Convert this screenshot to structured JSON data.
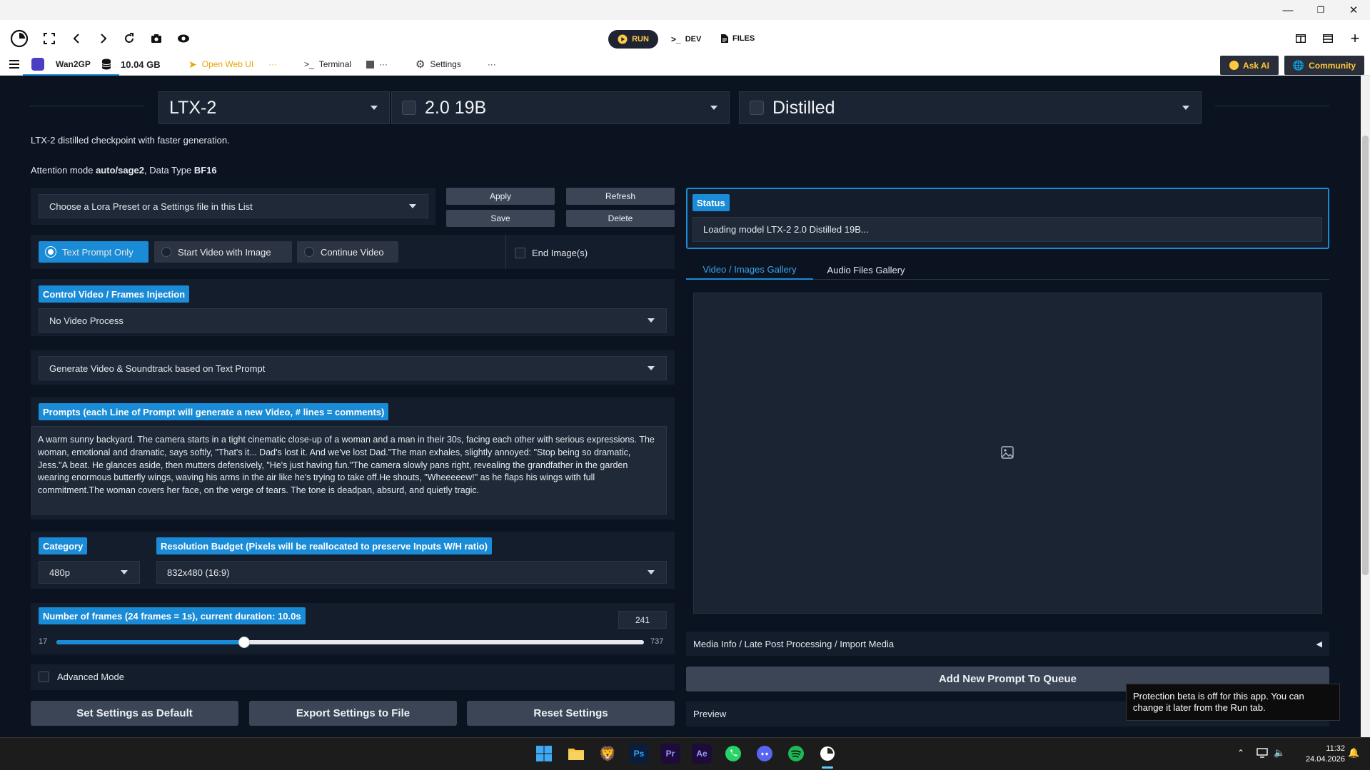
{
  "window": {
    "minimize_glyph": "—",
    "restore_glyph": "❐",
    "close_glyph": "✕"
  },
  "toolbar": {
    "run_label": "RUN",
    "dev_label": "DEV",
    "files_label": "FILES"
  },
  "tabs": {
    "app_name": "Wan2GP",
    "storage": "10.04 GB",
    "open_web_ui": "Open Web UI",
    "terminal": "Terminal",
    "settings": "Settings",
    "more": "···",
    "ask_ai": "Ask AI",
    "community": "Community"
  },
  "model": {
    "family": "LTX-2",
    "version": "2.0 19B",
    "variant": "Distilled",
    "description": "LTX-2 distilled checkpoint with faster generation.",
    "attention_prefix": "Attention mode ",
    "attention_mode": "auto/sage2",
    "datatype_prefix": ", Data Type ",
    "data_type": "BF16"
  },
  "lora": {
    "placeholder": "Choose a Lora Preset or a Settings file in this List",
    "apply": "Apply",
    "refresh": "Refresh",
    "save": "Save",
    "delete": "Delete"
  },
  "mode": {
    "options": [
      "Text Prompt Only",
      "Start Video with Image",
      "Continue Video"
    ],
    "selected": "Text Prompt Only",
    "end_image_label": "End Image(s)",
    "end_image_checked": false
  },
  "control_video": {
    "label": "Control Video / Frames Injection",
    "value": "No Video Process"
  },
  "generate_mode": {
    "value": "Generate Video & Soundtrack based on Text Prompt"
  },
  "prompts": {
    "label": "Prompts (each Line of Prompt will generate a new Video, # lines = comments)",
    "text": "A warm sunny backyard. The camera starts in a tight cinematic close-up of a woman and a man in their 30s, facing each other with serious expressions. The woman, emotional and dramatic, says softly, \"That's it... Dad's lost it. And we've lost Dad.\"The man exhales, slightly annoyed: \"Stop being so dramatic, Jess.\"A beat. He glances aside, then mutters defensively, \"He's just having fun.\"The camera slowly pans right, revealing the grandfather in the garden wearing enormous butterfly wings, waving his arms in the air like he's trying to take off.He shouts, \"Wheeeeew!\" as he flaps his wings with full commitment.The woman covers her face, on the verge of tears. The tone is deadpan, absurd, and quietly tragic."
  },
  "category": {
    "label": "Category",
    "value": "480p"
  },
  "resolution": {
    "label": "Resolution Budget (Pixels will be reallocated to preserve Inputs W/H ratio)",
    "value": "832x480 (16:9)"
  },
  "frames": {
    "label": "Number of frames (24 frames = 1s), current duration: 10.0s",
    "value": "241",
    "min": "17",
    "max": "737",
    "fraction": 0.32
  },
  "advanced": {
    "label": "Advanced Mode",
    "checked": false
  },
  "buttons": {
    "set_default": "Set Settings as Default",
    "export": "Export Settings to File",
    "reset": "Reset Settings"
  },
  "status": {
    "label": "Status",
    "text": "Loading model LTX-2 2.0 Distilled 19B..."
  },
  "gallery": {
    "tabs": [
      "Video / Images Gallery",
      "Audio Files Gallery"
    ],
    "active_tab": "Video / Images Gallery"
  },
  "media_info": {
    "label": "Media Info / Late Post Processing / Import Media",
    "arrow": "◀"
  },
  "queue_button": "Add New Prompt To Queue",
  "preview_label": "Preview",
  "toast": "Protection beta is off for this app. You can change it later from the Run tab.",
  "taskbar": {
    "apps": [
      "Ps",
      "Pr",
      "Ae"
    ],
    "time": "11:32",
    "date": "24.04.2026"
  },
  "colors": {
    "accent_blue": "#1a8bd6",
    "background": "#0b1321",
    "panel": "#141d2c",
    "run_yellow": "#ffc94a"
  }
}
